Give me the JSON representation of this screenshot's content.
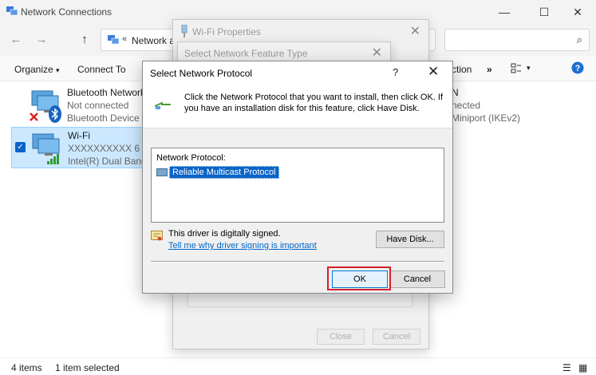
{
  "explorer": {
    "window_title": "Network Connections",
    "address_chevron": "«",
    "address_text": "Network an",
    "commands": {
      "organize": "Organize",
      "organize_arrow": "▾",
      "connect_to": "Connect To",
      "more": "»"
    },
    "adapters": [
      {
        "name": "Bluetooth Network C",
        "status": "Not connected",
        "device": "Bluetooth Device (Pe"
      },
      {
        "name": "Wi-Fi",
        "status": "XXXXXXXXXX 6",
        "device": "Intel(R) Dual Band W"
      }
    ],
    "right_column": {
      "name_fragment": "N",
      "status_fragment": "nected",
      "device_fragment": "Miniport (IKEv2)",
      "cmd_fragment": "ction"
    },
    "status": {
      "items": "4 items",
      "selected": "1 item selected"
    }
  },
  "wifi_properties": {
    "title": "Wi-Fi Properties",
    "close_label": "Close",
    "cancel_label": "Cancel"
  },
  "feature_type_dialog": {
    "title": "Select Network Feature Type"
  },
  "protocol_dialog": {
    "title": "Select Network Protocol",
    "help": "?",
    "instruction": "Click the Network Protocol that you want to install, then click OK. If you have an installation disk for this feature, click Have Disk.",
    "list_header": "Network Protocol:",
    "selected_protocol": "Reliable Multicast Protocol",
    "signed_text": "This driver is digitally signed.",
    "signing_link": "Tell me why driver signing is important",
    "have_disk_label": "Have Disk...",
    "ok_label": "OK",
    "cancel_label": "Cancel"
  },
  "icons": [
    "network-connections-icon",
    "back-arrow-icon",
    "forward-arrow-icon",
    "up-arrow-icon",
    "search-icon",
    "view-layout-icon",
    "help-icon",
    "computer-network-icon",
    "bluetooth-icon",
    "disconnected-x-icon",
    "signal-bars-icon",
    "network-protocol-icon",
    "certificate-icon",
    "close-icon",
    "minimize-icon",
    "maximize-icon"
  ],
  "colors": {
    "accent": "#0078d7",
    "selection": "#cce8ff",
    "list_selection": "#0a64c8",
    "highlight_box": "#d3202a",
    "link": "#0066cc"
  }
}
